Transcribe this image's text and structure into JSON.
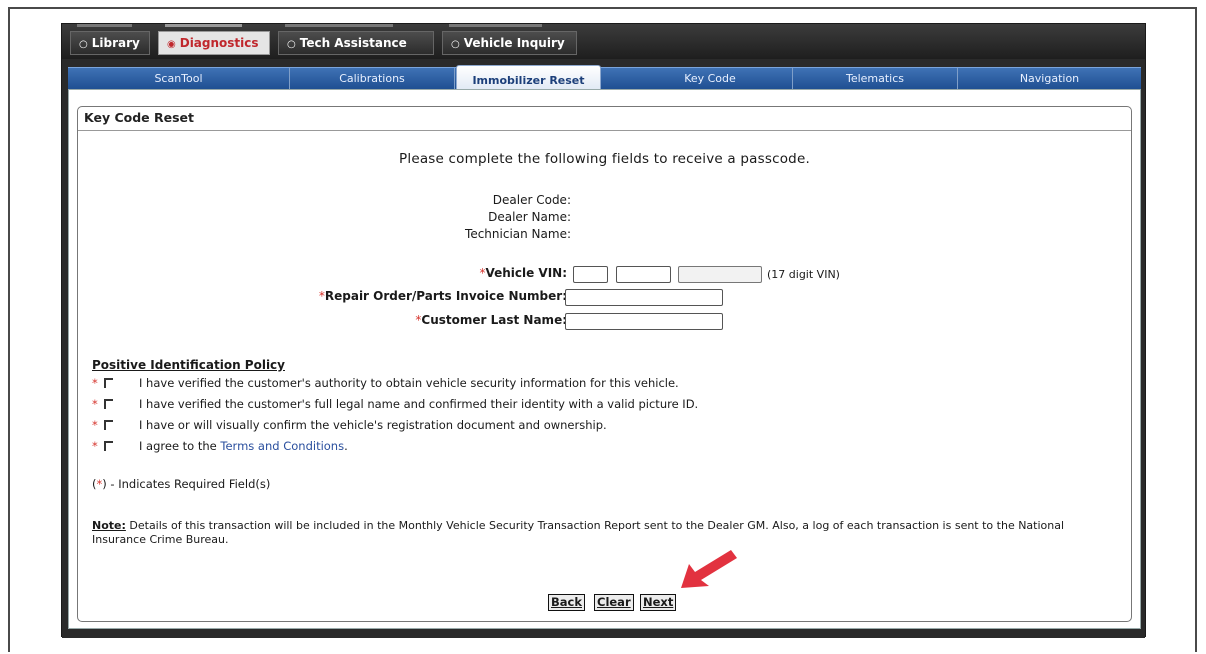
{
  "top_tabs": [
    {
      "label": "Library",
      "active": false
    },
    {
      "label": "Diagnostics",
      "active": true
    },
    {
      "label": "Tech Assistance",
      "active": false
    },
    {
      "label": "Vehicle Inquiry",
      "active": false
    }
  ],
  "sub_tabs": [
    "ScanTool",
    "Calibrations",
    "Immobilizer Reset",
    "Key Code",
    "Telematics",
    "Navigation"
  ],
  "active_sub_tab": "Immobilizer Reset",
  "panel_title": "Key Code Reset",
  "intro": "Please complete the following fields to receive a passcode.",
  "dealer": {
    "code_label": "Dealer Code:",
    "name_label": "Dealer Name:",
    "technician_label": "Technician Name:"
  },
  "form": {
    "required_mark": "*",
    "vin_label": "Vehicle VIN:",
    "vin_hint": "(17 digit VIN)",
    "repair_order_label": "Repair Order/Parts Invoice Number:",
    "customer_last_name_label": "Customer Last Name:"
  },
  "policy": {
    "title": "Positive Identification Policy",
    "items": [
      "I have verified the customer's authority to obtain vehicle security information for this vehicle.",
      "I have verified the customer's full legal name and confirmed their identity with a valid picture ID.",
      "I have or will visually confirm the vehicle's registration document and ownership."
    ],
    "agree_prefix": "I agree to the ",
    "terms_link": "Terms and Conditions",
    "agree_suffix": "."
  },
  "required_note": {
    "open": "(",
    "star": "*",
    "close": ")",
    "text": " - Indicates Required Field(s)"
  },
  "note": {
    "label": "Note:",
    "text": " Details of this transaction will be included in the Monthly Vehicle Security Transaction Report sent to the Dealer GM. Also, a log of each transaction is sent to the National Insurance Crime Bureau."
  },
  "buttons": {
    "back": "Back",
    "clear": "Clear",
    "next": "Next"
  },
  "colors": {
    "accent_red": "#d6332c",
    "nav_blue": "#2a5ea6",
    "link_blue": "#2a4f9e"
  }
}
